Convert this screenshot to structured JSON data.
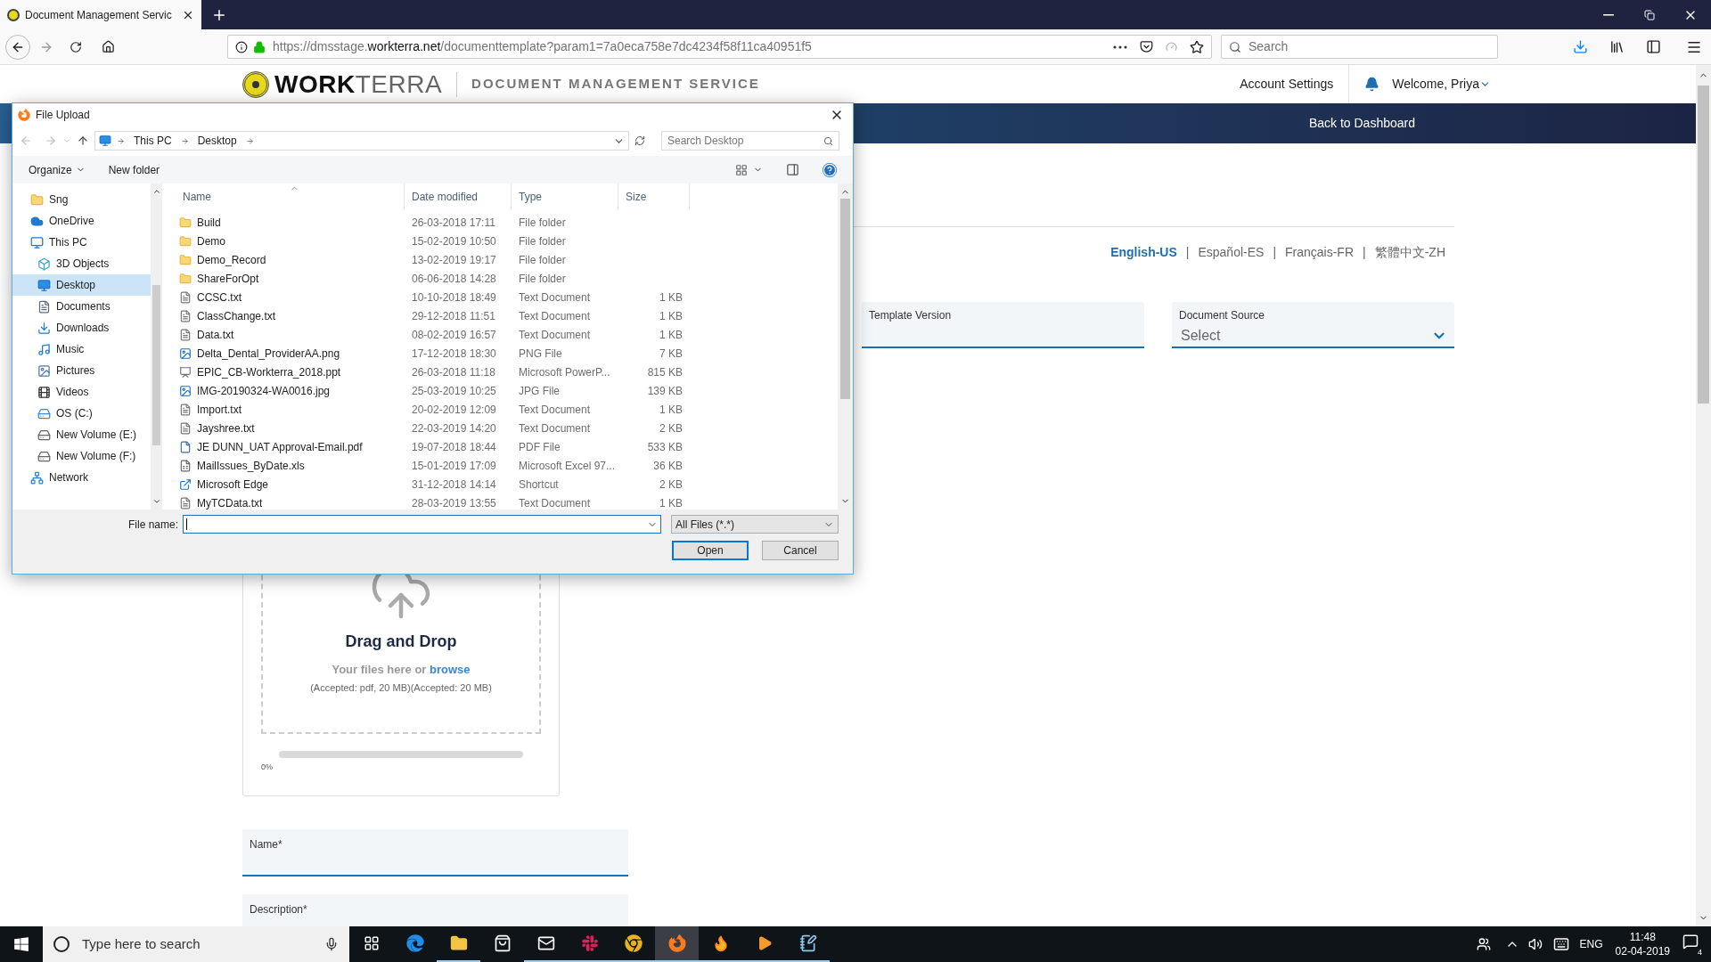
{
  "browser": {
    "tab": {
      "title": "Document Management Servic",
      "selected": true
    },
    "url": {
      "prefix": "https://dmsstage.",
      "domain": "workterra.net",
      "path": "/documenttemplate?param1=7a0eca758e7dc4234f58f11ca40951f5"
    },
    "search": {
      "placeholder": "Search"
    }
  },
  "header": {
    "logo_bold": "WORK",
    "logo_light": "TERRA",
    "service": "DOCUMENT MANAGEMENT SERVICE",
    "account": "Account Settings",
    "welcome": "Welcome, Priya",
    "back": "Back to Dashboard"
  },
  "languages": [
    {
      "label": "English-US",
      "selected": true
    },
    {
      "label": "Español-ES",
      "selected": false
    },
    {
      "label": "Français-FR",
      "selected": false
    },
    {
      "label": "繁體中文-ZH",
      "selected": false
    }
  ],
  "separator": "|",
  "fields": [
    {
      "label": "Template Version",
      "kind": "text"
    },
    {
      "label": "Document Source",
      "kind": "select",
      "placeholder": "Select"
    }
  ],
  "upload": {
    "title": "Drag and Drop",
    "hint": "Your files here or",
    "link": "browse",
    "accepted": "(Accepted: pdf, 20 MB)(Accepted: 20 MB)",
    "level": 0,
    "percent": "0%"
  },
  "form_fields": [
    {
      "label": "Name*"
    },
    {
      "label": "Description*"
    }
  ],
  "dialog": {
    "title": "File Upload",
    "breadcrumb": [
      "This PC",
      "Desktop"
    ],
    "search_placeholder": "Search Desktop",
    "organize": "Organize",
    "new_folder": "New folder",
    "nav": [
      {
        "label": "Sng",
        "kind": "folder",
        "selected": false
      },
      {
        "label": "OneDrive",
        "kind": "cloud",
        "selected": false
      },
      {
        "label": "This PC",
        "kind": "pc",
        "selected": false,
        "children": [
          {
            "label": "3D Objects",
            "kind": "cube",
            "selected": false
          },
          {
            "label": "Desktop",
            "kind": "desktop",
            "selected": true
          },
          {
            "label": "Documents",
            "kind": "documents",
            "selected": false
          },
          {
            "label": "Downloads",
            "kind": "downloads",
            "selected": false
          },
          {
            "label": "Music",
            "kind": "music",
            "selected": false
          },
          {
            "label": "Pictures",
            "kind": "pictures",
            "selected": false
          },
          {
            "label": "Videos",
            "kind": "videos",
            "selected": false
          },
          {
            "label": "OS (C:)",
            "kind": "os",
            "selected": false
          },
          {
            "label": "New Volume (E:)",
            "kind": "drive",
            "selected": false
          },
          {
            "label": "New Volume (F:)",
            "kind": "drive",
            "selected": false
          }
        ]
      },
      {
        "label": "Network",
        "kind": "network",
        "selected": false
      }
    ],
    "columns": [
      {
        "label": "Name",
        "sorted": true
      },
      {
        "label": "Date modified",
        "sorted": false
      },
      {
        "label": "Type",
        "sorted": false
      },
      {
        "label": "Size",
        "sorted": false
      }
    ],
    "files": [
      {
        "name": "Build",
        "date": "26-03-2018 17:11",
        "type": "File folder",
        "kind": "folder",
        "selected": false
      },
      {
        "name": "Demo",
        "date": "15-02-2019 10:50",
        "type": "File folder",
        "kind": "folder",
        "selected": false
      },
      {
        "name": "Demo_Record",
        "date": "13-02-2019 19:17",
        "type": "File folder",
        "kind": "folder",
        "selected": false
      },
      {
        "name": "ShareForOpt",
        "date": "06-06-2018 14:28",
        "type": "File folder",
        "kind": "folder",
        "selected": false
      },
      {
        "name": "CCSC.txt",
        "date": "10-10-2018 18:49",
        "type": "Text Document",
        "size": "1 KB",
        "kind": "text",
        "selected": false
      },
      {
        "name": "ClassChange.txt",
        "date": "29-12-2018 11:51",
        "type": "Text Document",
        "size": "1 KB",
        "kind": "text",
        "selected": false
      },
      {
        "name": "Data.txt",
        "date": "08-02-2019 16:57",
        "type": "Text Document",
        "size": "1 KB",
        "kind": "text",
        "selected": false
      },
      {
        "name": "Delta_Dental_ProviderAA.png",
        "date": "17-12-2018 18:30",
        "type": "PNG File",
        "size": "7 KB",
        "kind": "image",
        "selected": false
      },
      {
        "name": "EPIC_CB-Workterra_2018.ppt",
        "date": "26-03-2018 11:18",
        "type": "Microsoft PowerP...",
        "size": "815 KB",
        "kind": "slides",
        "selected": false
      },
      {
        "name": "IMG-20190324-WA0016.jpg",
        "date": "25-03-2019 10:25",
        "type": "JPG File",
        "size": "139 KB",
        "kind": "image",
        "selected": false
      },
      {
        "name": "Import.txt",
        "date": "20-02-2019 12:09",
        "type": "Text Document",
        "size": "1 KB",
        "kind": "text",
        "selected": false
      },
      {
        "name": "Jayshree.txt",
        "date": "22-03-2019 14:20",
        "type": "Text Document",
        "size": "2 KB",
        "kind": "text",
        "selected": false
      },
      {
        "name": "JE DUNN_UAT Approval-Email.pdf",
        "date": "19-07-2018 18:44",
        "type": "PDF File",
        "size": "533 KB",
        "kind": "pdf",
        "selected": false
      },
      {
        "name": "MailIssues_ByDate.xls",
        "date": "15-01-2019 17:09",
        "type": "Microsoft Excel 97...",
        "size": "36 KB",
        "kind": "sheet",
        "selected": false
      },
      {
        "name": "Microsoft Edge",
        "date": "31-12-2018 14:14",
        "type": "Shortcut",
        "size": "2 KB",
        "kind": "shortcut",
        "selected": false
      },
      {
        "name": "MyTCData.txt",
        "date": "28-03-2019 13:55",
        "type": "Text Document",
        "size": "1 KB",
        "kind": "text",
        "selected": false
      }
    ],
    "filename_label": "File name:",
    "filter": "All Files (*.*)",
    "open": "Open",
    "cancel": "Cancel"
  },
  "taskbar": {
    "search_placeholder": "Type here to search",
    "apps": [
      {
        "kind": "taskview",
        "running": false,
        "selected": false
      },
      {
        "kind": "edge",
        "running": false,
        "selected": false
      },
      {
        "kind": "explorer",
        "running": true,
        "selected": false
      },
      {
        "kind": "store",
        "running": false,
        "selected": false
      },
      {
        "kind": "mail",
        "running": true,
        "selected": false
      },
      {
        "kind": "slack",
        "running": true,
        "selected": false
      },
      {
        "kind": "chrome",
        "running": true,
        "selected": false
      },
      {
        "kind": "firefox",
        "running": true,
        "selected": true
      },
      {
        "kind": "flame",
        "running": true,
        "selected": false
      },
      {
        "kind": "media",
        "running": true,
        "selected": false
      },
      {
        "kind": "notes",
        "running": true,
        "selected": false
      }
    ],
    "language": "ENG",
    "time": "11:48",
    "date": "02-04-2019",
    "notifications": "4"
  }
}
